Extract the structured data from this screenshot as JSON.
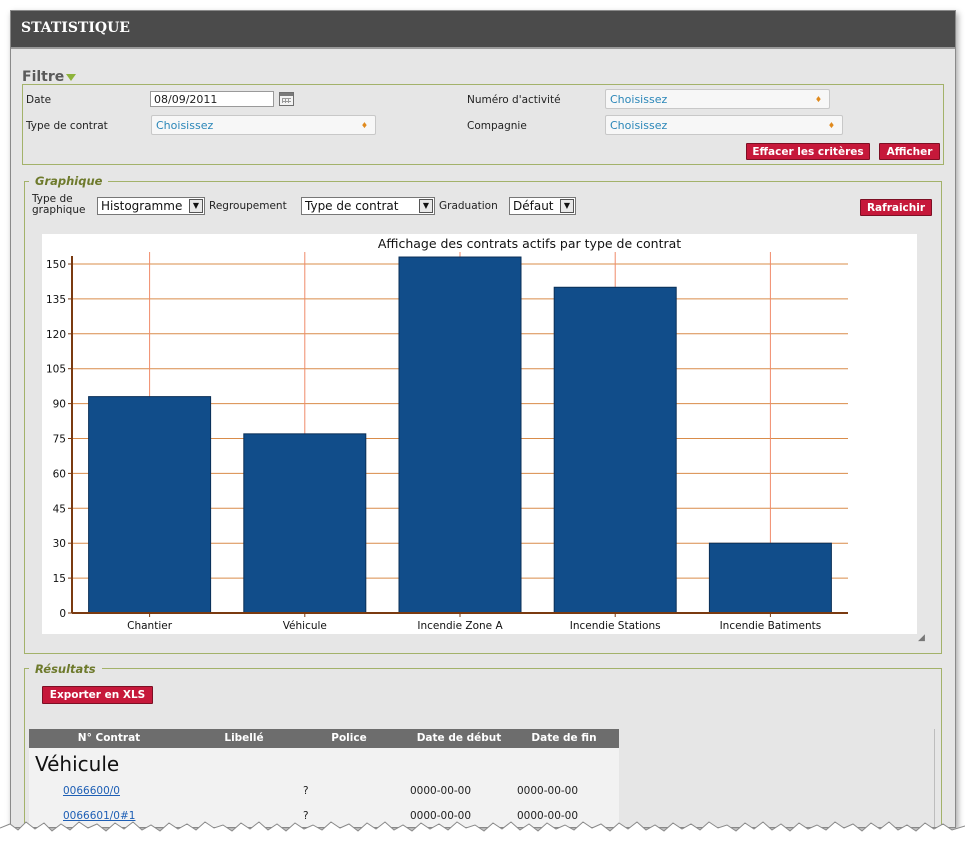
{
  "app": {
    "title": "STATISTIQUE"
  },
  "filter": {
    "heading": "Filtre",
    "date_label": "Date",
    "date_value": "08/09/2011",
    "contract_type_label": "Type de contrat",
    "contract_type_value": "Choisissez",
    "activity_label": "Numéro d'activité",
    "activity_value": "Choisissez",
    "company_label": "Compagnie",
    "company_value": "Choisissez",
    "clear_button": "Effacer les critères",
    "show_button": "Afficher"
  },
  "graph": {
    "legend": "Graphique",
    "type_label_1": "Type de",
    "type_label_2": "graphique",
    "type_value": "Histogramme",
    "grouping_label": "Regroupement",
    "grouping_value": "Type de contrat",
    "graduation_label": "Graduation",
    "graduation_value": "Défaut",
    "refresh_button": "Rafraichir"
  },
  "chart_data": {
    "type": "bar",
    "title": "Affichage des contrats actifs par type de contrat",
    "categories": [
      "Chantier",
      "Véhicule",
      "Incendie Zone A",
      "Incendie Stations",
      "Incendie Batiments"
    ],
    "values": [
      93,
      77,
      153,
      140,
      30
    ],
    "ylim": [
      0,
      150
    ],
    "yticks": [
      0,
      15,
      30,
      45,
      60,
      75,
      90,
      105,
      120,
      135,
      150
    ],
    "xlabel": "",
    "ylabel": "",
    "colors": {
      "bar": "#114d8a",
      "bar_border": "#0a2f57",
      "grid": "#d98c4a",
      "axis": "#7a3a10",
      "vgrid": "#f08a6a"
    }
  },
  "results": {
    "legend": "Résultats",
    "export_button": "Exporter en XLS",
    "columns": [
      "N° Contrat",
      "Libellé",
      "Police",
      "Date de début",
      "Date de fin"
    ],
    "group": "Véhicule",
    "rows": [
      {
        "contract": "0066600/0",
        "label": "",
        "police": "?",
        "start": "0000-00-00",
        "end": "0000-00-00"
      },
      {
        "contract": "0066601/0#1",
        "label": "",
        "police": "?",
        "start": "0000-00-00",
        "end": "0000-00-00"
      }
    ]
  },
  "icons": {
    "calendar": "calendar-icon",
    "filter_toggle": "triangle-down-icon",
    "resize": "resize-grip-icon"
  }
}
